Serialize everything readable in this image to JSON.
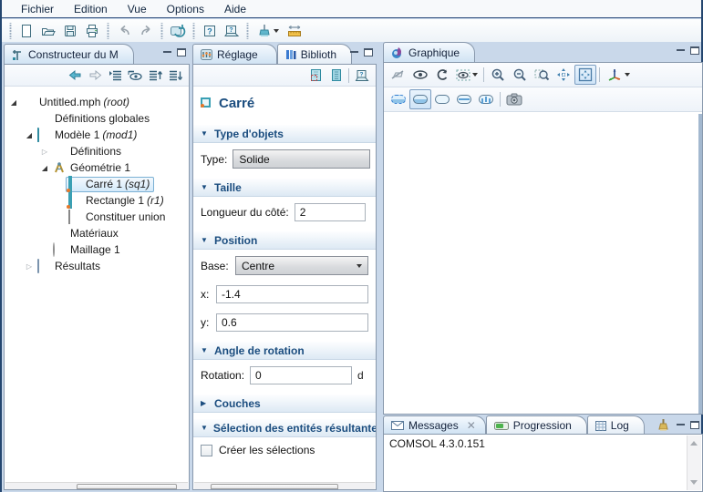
{
  "menu": {
    "items": [
      "Fichier",
      "Edition",
      "Vue",
      "Options",
      "Aide"
    ]
  },
  "main_toolbar": {
    "icons": [
      "new-file",
      "open-file",
      "save",
      "print",
      "undo",
      "redo",
      "update-solution",
      "help",
      "documentation",
      "clear-paint",
      "measure"
    ]
  },
  "model_builder": {
    "tab": "Constructeur du M",
    "toolbar_icons": [
      "back",
      "forward",
      "collapse-all",
      "show",
      "move-up",
      "move-down"
    ],
    "tree": [
      {
        "label": "Untitled.mph",
        "suffix": "(root)"
      },
      {
        "label": "Définitions globales"
      },
      {
        "label": "Modèle 1",
        "suffix": "(mod1)"
      },
      {
        "label": "Définitions"
      },
      {
        "label": "Géométrie 1"
      },
      {
        "label": "Carré 1",
        "suffix": "(sq1)"
      },
      {
        "label": "Rectangle 1",
        "suffix": "(r1)"
      },
      {
        "label": "Constituer union"
      },
      {
        "label": "Matériaux"
      },
      {
        "label": "Maillage 1"
      },
      {
        "label": "Résultats"
      }
    ]
  },
  "settings": {
    "tabs": {
      "settings": "Réglage",
      "library": "Biblioth"
    },
    "toolbar_icons": [
      "build-selected",
      "build-all",
      "documentation"
    ],
    "title": "Carré",
    "type_section": {
      "header": "Type d'objets",
      "label": "Type:",
      "value": "Solide"
    },
    "size_section": {
      "header": "Taille",
      "label": "Longueur du côté:",
      "value": "2"
    },
    "position_section": {
      "header": "Position",
      "base_label": "Base:",
      "base_value": "Centre",
      "x_label": "x:",
      "x_value": "-1.4",
      "y_label": "y:",
      "y_value": "0.6"
    },
    "rotation_section": {
      "header": "Angle de rotation",
      "label": "Rotation:",
      "value": "0",
      "unit": "d"
    },
    "layers_section": {
      "header": "Couches"
    },
    "selection_section": {
      "header": "Sélection des entités résultante",
      "checkbox_label": "Créer les sélections"
    }
  },
  "graphics": {
    "tab": "Graphique",
    "toolbar1_icons": [
      "hide",
      "visibility",
      "refresh",
      "view-options",
      "zoom-in",
      "zoom-out",
      "zoom-box",
      "zoom-extents",
      "fit-view",
      "axes-orientation"
    ],
    "toolbar2_icons": [
      "select-box",
      "select-rounded",
      "deselect",
      "select-line",
      "select-cross",
      "snapshot"
    ]
  },
  "messages": {
    "tabs": {
      "messages": "Messages",
      "progress": "Progression",
      "log": "Log"
    },
    "content": "COMSOL 4.3.0.151",
    "toolbar_icons": [
      "clear"
    ]
  }
}
